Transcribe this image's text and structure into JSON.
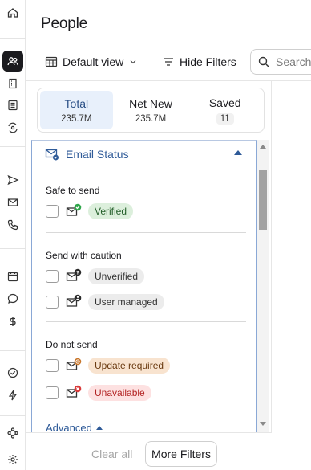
{
  "app": {
    "page_title": "People"
  },
  "rail": {
    "icons": [
      "home-icon",
      "people-icon",
      "building-icon",
      "list-icon",
      "refresh-eye-icon",
      "send-icon",
      "mail-icon",
      "phone-icon",
      "calendar-icon",
      "chat-icon",
      "dollar-icon",
      "check-circle-icon",
      "bolt-icon",
      "network-icon",
      "settings-icon"
    ],
    "active": "people-icon"
  },
  "toolbar": {
    "view_label": "Default view",
    "hide_filters_label": "Hide Filters",
    "search_placeholder": "Search"
  },
  "tabs": [
    {
      "label": "Total",
      "count": "235.7M",
      "selected": true
    },
    {
      "label": "Net New",
      "count": "235.7M",
      "selected": false
    },
    {
      "label": "Saved",
      "count": "11",
      "selected": false
    }
  ],
  "email_status": {
    "title": "Email Status",
    "groups": [
      {
        "label": "Safe to send",
        "options": [
          {
            "label": "Verified",
            "icon": "mail-check-icon",
            "color": "green"
          }
        ]
      },
      {
        "label": "Send with caution",
        "options": [
          {
            "label": "Unverified",
            "icon": "mail-question-icon",
            "color": "gray"
          },
          {
            "label": "User managed",
            "icon": "mail-user-icon",
            "color": "gray"
          }
        ]
      },
      {
        "label": "Do not send",
        "options": [
          {
            "label": "Update required",
            "icon": "mail-clock-icon",
            "color": "orange"
          },
          {
            "label": "Unavailable",
            "icon": "mail-x-icon",
            "color": "red"
          }
        ]
      }
    ],
    "advanced_label": "Advanced"
  },
  "footer": {
    "clear_all_label": "Clear all",
    "more_filters_label": "More Filters"
  },
  "colors": {
    "accent_blue": "#2e5a98",
    "selected_tab_bg": "#e8f0fb",
    "verified_green": "#2fa64a",
    "warn_orange": "#c8762b",
    "danger_red": "#d93a3a"
  }
}
